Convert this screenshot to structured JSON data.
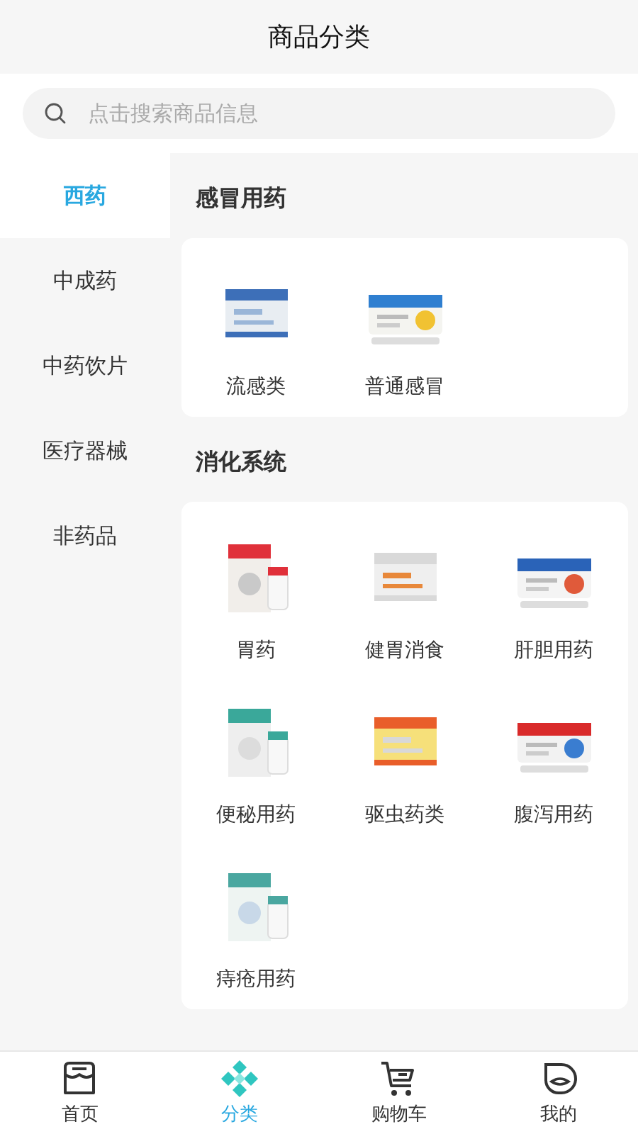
{
  "title": "商品分类",
  "search": {
    "placeholder": "点击搜索商品信息"
  },
  "sidebar": {
    "items": [
      {
        "label": "西药",
        "selected": true
      },
      {
        "label": "中成药",
        "selected": false
      },
      {
        "label": "中药饮片",
        "selected": false
      },
      {
        "label": "医疗器械",
        "selected": false
      },
      {
        "label": "非药品",
        "selected": false
      }
    ]
  },
  "sections": [
    {
      "title": "感冒用药",
      "items": [
        {
          "label": "流感类",
          "kind": "picture"
        },
        {
          "label": "普通感冒",
          "kind": "picture"
        }
      ]
    },
    {
      "title": "消化系统",
      "items": [
        {
          "label": "胃药",
          "kind": "picture"
        },
        {
          "label": "健胃消食",
          "kind": "picture"
        },
        {
          "label": "肝胆用药",
          "kind": "picture"
        },
        {
          "label": "便秘用药",
          "kind": "picture"
        },
        {
          "label": "驱虫药类",
          "kind": "picture"
        },
        {
          "label": "腹泻用药",
          "kind": "picture"
        },
        {
          "label": "痔疮用药",
          "kind": "picture"
        }
      ]
    }
  ],
  "tabbar": [
    {
      "label": "首页",
      "kind": "store",
      "selected": false
    },
    {
      "label": "分类",
      "kind": "category",
      "selected": true
    },
    {
      "label": "购物车",
      "kind": "cart",
      "selected": false
    },
    {
      "label": "我的",
      "kind": "face",
      "selected": false
    }
  ]
}
